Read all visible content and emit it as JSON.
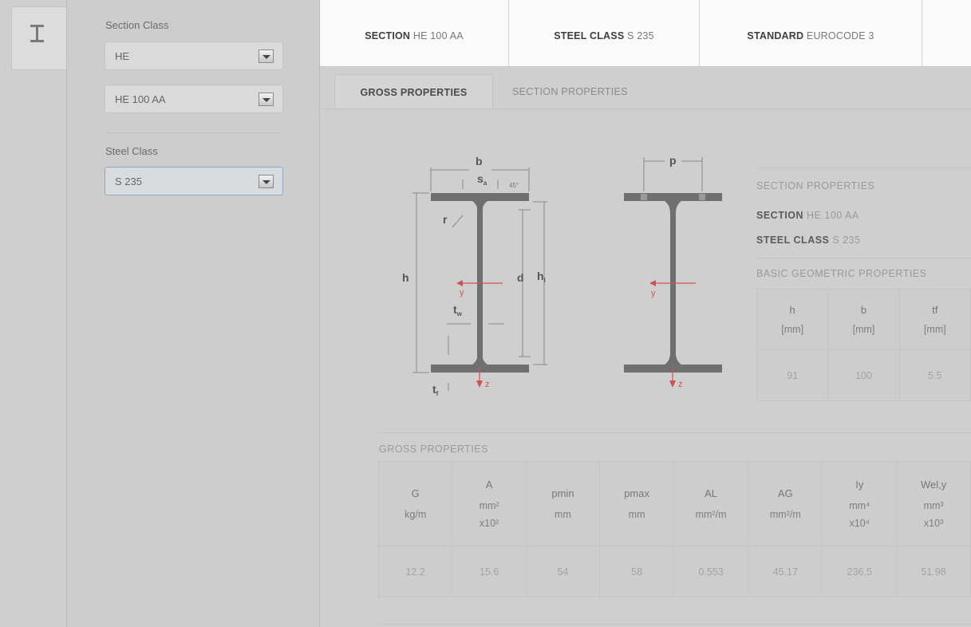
{
  "rail": {
    "icon": "i-beam-icon"
  },
  "sidebar": {
    "section_class_label": "Section Class",
    "section_class_value": "HE",
    "section_value": "HE 100 AA",
    "steel_class_label": "Steel Class",
    "steel_class_value": "S 235"
  },
  "infobar": [
    {
      "key": "SECTION",
      "value": "HE 100 AA"
    },
    {
      "key": "STEEL CLASS",
      "value": "S 235"
    },
    {
      "key": "STANDARD",
      "value": "EUROCODE 3"
    }
  ],
  "tabs": {
    "gross": "GROSS PROPERTIES",
    "section": "SECTION PROPERTIES"
  },
  "diagram": {
    "b": "b",
    "s": "s",
    "s_sub": "a",
    "angle": "45°",
    "r": "r",
    "h": "h",
    "d": "d",
    "h1": "h",
    "h1_sub": "l",
    "tw": "t",
    "tw_sub": "w",
    "tf": "t",
    "tf_sub": "f",
    "y": "y",
    "z": "z",
    "p": "p"
  },
  "section_props": {
    "title": "SECTION PROPERTIES",
    "section_key": "SECTION",
    "section_value": "HE 100 AA",
    "steel_key": "STEEL CLASS",
    "steel_value": "S 235",
    "basic_title": "BASIC GEOMETRIC PROPERTIES",
    "columns": [
      {
        "sym": "h",
        "unit": "[mm]",
        "value": "91"
      },
      {
        "sym": "b",
        "unit": "[mm]",
        "value": "100"
      },
      {
        "sym": "tf",
        "unit": "[mm]",
        "value": "5.5"
      }
    ]
  },
  "gross": {
    "title": "GROSS PROPERTIES",
    "columns": [
      {
        "sym": "G",
        "unit": "kg/m",
        "value": "12.2"
      },
      {
        "sym": "A",
        "unit": "mm²",
        "unit2": "x10²",
        "value": "15.6"
      },
      {
        "sym": "pmin",
        "unit": "mm",
        "value": "54"
      },
      {
        "sym": "pmax",
        "unit": "mm",
        "value": "58"
      },
      {
        "sym": "AL",
        "unit": "mm²/m",
        "value": "0.553"
      },
      {
        "sym": "AG",
        "unit": "mm²/m",
        "value": "45.17"
      },
      {
        "sym": "Iy",
        "unit": "mm⁴",
        "unit2": "x10⁴",
        "value": "236.5"
      },
      {
        "sym": "Wel,y",
        "unit": "mm³",
        "unit2": "x10³",
        "value": "51.98"
      }
    ]
  }
}
